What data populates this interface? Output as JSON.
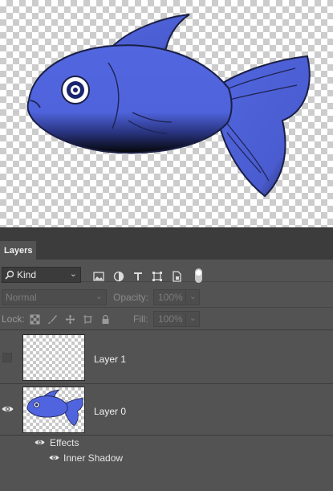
{
  "panel": {
    "tab_label": "Layers",
    "filter": {
      "kind_label": "Kind",
      "icons": [
        "pixel-filter-icon",
        "adjustment-filter-icon",
        "type-filter-icon",
        "shape-filter-icon",
        "smart-object-filter-icon"
      ],
      "filter_toggle_on": true
    },
    "blend_mode": "Normal",
    "opacity_label": "Opacity:",
    "opacity_value": "100%",
    "lock_label": "Lock:",
    "fill_label": "Fill:",
    "fill_value": "100%",
    "lock_icons": [
      "lock-transparent-pixels-icon",
      "lock-image-pixels-icon",
      "lock-position-icon",
      "lock-artboard-icon",
      "lock-all-icon"
    ]
  },
  "layers": [
    {
      "name": "Layer 1",
      "visible": false,
      "thumbnail": "empty"
    },
    {
      "name": "Layer 0",
      "visible": true,
      "thumbnail": "fish"
    }
  ],
  "effects": {
    "label": "Effects",
    "items": [
      "Inner Shadow"
    ]
  },
  "colors": {
    "fish_fill": "#4f64de",
    "panel_bg": "#535353",
    "header_bg": "#3c3c3c"
  }
}
